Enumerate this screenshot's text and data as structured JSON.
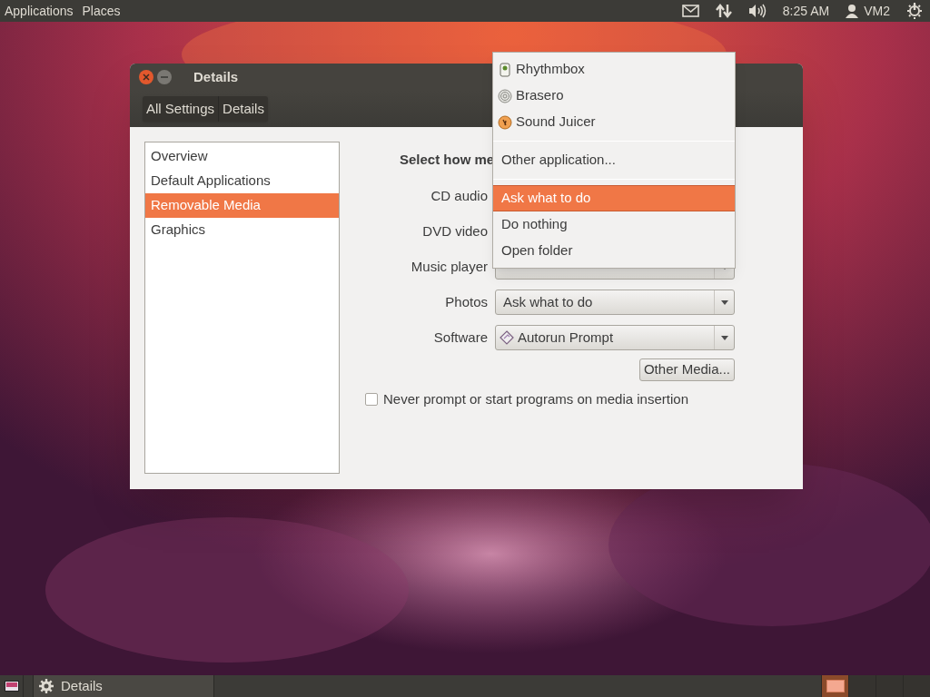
{
  "top_panel": {
    "menus": [
      "Applications",
      "Places"
    ],
    "clock": "8:25 AM",
    "user": "VM2"
  },
  "window": {
    "title": "Details",
    "breadcrumbs": [
      "All Settings",
      "Details"
    ],
    "sidebar": {
      "items": [
        {
          "label": "Overview",
          "selected": false
        },
        {
          "label": "Default Applications",
          "selected": false
        },
        {
          "label": "Removable Media",
          "selected": true
        },
        {
          "label": "Graphics",
          "selected": false
        }
      ]
    },
    "heading": "Select how me",
    "rows": [
      {
        "kind": "hidden",
        "label": "CD audio"
      },
      {
        "kind": "hidden",
        "label": "DVD video"
      },
      {
        "kind": "covered",
        "label": "Music player"
      },
      {
        "kind": "combo",
        "label": "Photos",
        "value": "Ask what to do"
      },
      {
        "kind": "combo_icon",
        "label": "Software",
        "value": "Autorun Prompt"
      }
    ],
    "other_media_button": "Other Media...",
    "never_prompt": {
      "label": "Never prompt or start programs on media insertion",
      "checked": false
    }
  },
  "dropdown_menu": {
    "items": [
      {
        "kind": "app",
        "label": "Rhythmbox",
        "selected": false
      },
      {
        "kind": "app",
        "label": "Brasero",
        "selected": false
      },
      {
        "kind": "app",
        "label": "Sound Juicer",
        "selected": false
      },
      {
        "kind": "separator"
      },
      {
        "kind": "action",
        "label": "Other application...",
        "selected": false
      },
      {
        "kind": "separator"
      },
      {
        "kind": "action",
        "label": "Ask what to do",
        "selected": true
      },
      {
        "kind": "action",
        "label": "Do nothing",
        "selected": false
      },
      {
        "kind": "action",
        "label": "Open folder",
        "selected": false
      }
    ]
  },
  "taskbar": {
    "window_button": "Details",
    "workspaces": [
      {
        "selected": true
      },
      {
        "selected": false
      },
      {
        "selected": false
      },
      {
        "selected": false
      }
    ]
  }
}
